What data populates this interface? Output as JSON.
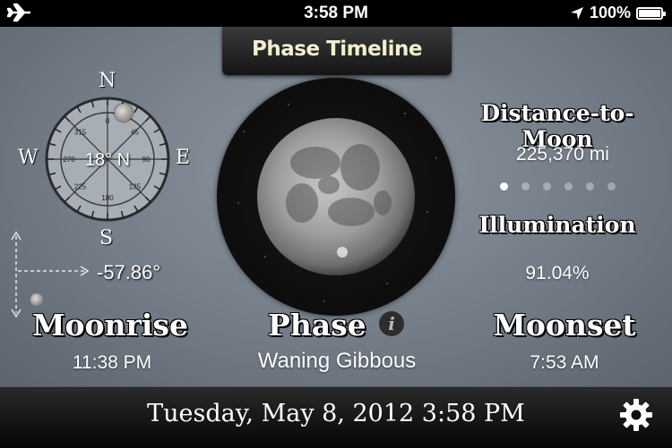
{
  "status_bar": {
    "time": "3:58 PM",
    "battery": "100%",
    "airplane_icon": "airplane-icon",
    "location_icon": "location-arrow-icon",
    "battery_level": 1.0
  },
  "header": {
    "title": "Phase Timeline"
  },
  "compass": {
    "north": "N",
    "south": "S",
    "east": "E",
    "west": "W",
    "ticks": [
      "0",
      "45",
      "90",
      "135",
      "180",
      "225",
      "270",
      "315"
    ],
    "heading": "18° N"
  },
  "altitude": {
    "value": "-57.86°"
  },
  "distance": {
    "label": "Distance-to-Moon",
    "value": "225,370 mi"
  },
  "page_dots": {
    "count": 6,
    "active": 0
  },
  "illumination": {
    "label": "Illumination",
    "value": "91.04%"
  },
  "moonrise": {
    "label": "Moonrise",
    "value": "11:38 PM"
  },
  "phase": {
    "label": "Phase",
    "value": "Waning Gibbous",
    "info_icon": "info-icon"
  },
  "moonset": {
    "label": "Moonset",
    "value": "7:53 AM"
  },
  "footer": {
    "datetime": "Tuesday, May 8, 2012 3:58 PM",
    "settings_icon": "gear-icon"
  }
}
